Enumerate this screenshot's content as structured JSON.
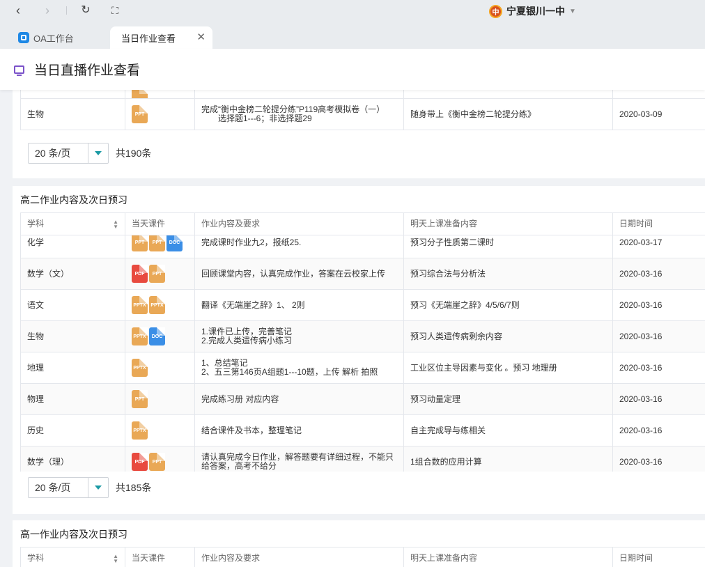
{
  "browser": {
    "school_logo_char": "中",
    "school_name": "宁夏银川一中",
    "tabs": [
      {
        "label": "OA工作台"
      },
      {
        "label": "当日作业查看"
      }
    ]
  },
  "page": {
    "title": "当日直播作业查看"
  },
  "columns": [
    "学科",
    "当天课件",
    "作业内容及要求",
    "明天上课准备内容",
    "日期时间"
  ],
  "panel1": {
    "rows": [
      {
        "subject": "生物",
        "files": [
          "PPT"
        ],
        "content": [
          "完成“衡中金榜二轮提分练”P119高考模拟卷（一）",
          "　　选择题1---6；非选择题29"
        ],
        "prep": "随身带上《衡中金榜二轮提分练》",
        "date": "2020-03-09"
      }
    ],
    "page_size": "20 条/页",
    "total": "共190条"
  },
  "panel2": {
    "title": "高二作业内容及次日预习",
    "rows": [
      {
        "subject": "化学",
        "files": [
          "PPT",
          "PPT",
          "DOC"
        ],
        "content": [
          "完成课时作业九2，报纸25."
        ],
        "prep": "预习分子性质第二课时",
        "date": "2020-03-17"
      },
      {
        "subject": "数学（文）",
        "files": [
          "PDF",
          "PPT"
        ],
        "content": [
          "回顾课堂内容，认真完成作业，答案在云校家上传"
        ],
        "prep": "预习综合法与分析法",
        "date": "2020-03-16"
      },
      {
        "subject": "语文",
        "files": [
          "PPTX",
          "PPTX"
        ],
        "content": [
          "翻译《无端崖之辞》1、 2则"
        ],
        "prep": "预习《无端崖之辞》4/5/6/7则",
        "date": "2020-03-16"
      },
      {
        "subject": "生物",
        "files": [
          "PPTX",
          "DOC"
        ],
        "content": [
          "1.课件已上传，完善笔记",
          "2.完成人类遗传病小练习"
        ],
        "prep": "预习人类遗传病剩余内容",
        "date": "2020-03-16"
      },
      {
        "subject": "地理",
        "files": [
          "PPTX"
        ],
        "content": [
          "1、总结笔记",
          "2、五三第146页A组题1---10题，上传  解析 拍照"
        ],
        "prep": "工业区位主导因素与变化  。预习 地理册",
        "date": "2020-03-16"
      },
      {
        "subject": "物理",
        "files": [
          "PPT"
        ],
        "content": [
          "完成练习册  对应内容"
        ],
        "prep": "预习动量定理",
        "date": "2020-03-16"
      },
      {
        "subject": "历史",
        "files": [
          "PPTX"
        ],
        "content": [
          "结合课件及书本，整理笔记"
        ],
        "prep": "自主完成导与练相关",
        "date": "2020-03-16"
      },
      {
        "subject": "数学（理）",
        "files": [
          "PDF",
          "PPT"
        ],
        "content": [
          "请认真完成今日作业，解答题要有详细过程，不能只",
          "给答案，高考不给分"
        ],
        "prep": "1组合数的应用计算",
        "date": "2020-03-16"
      }
    ],
    "page_size": "20 条/页",
    "total": "共185条"
  },
  "panel3": {
    "title": "高一作业内容及次日预习"
  },
  "colors": {
    "accent": "#1b9aa4",
    "ppt": "#e9a856",
    "doc": "#3a8ee6",
    "pdf": "#e84a3f",
    "header_icon": "#7b52c9"
  }
}
